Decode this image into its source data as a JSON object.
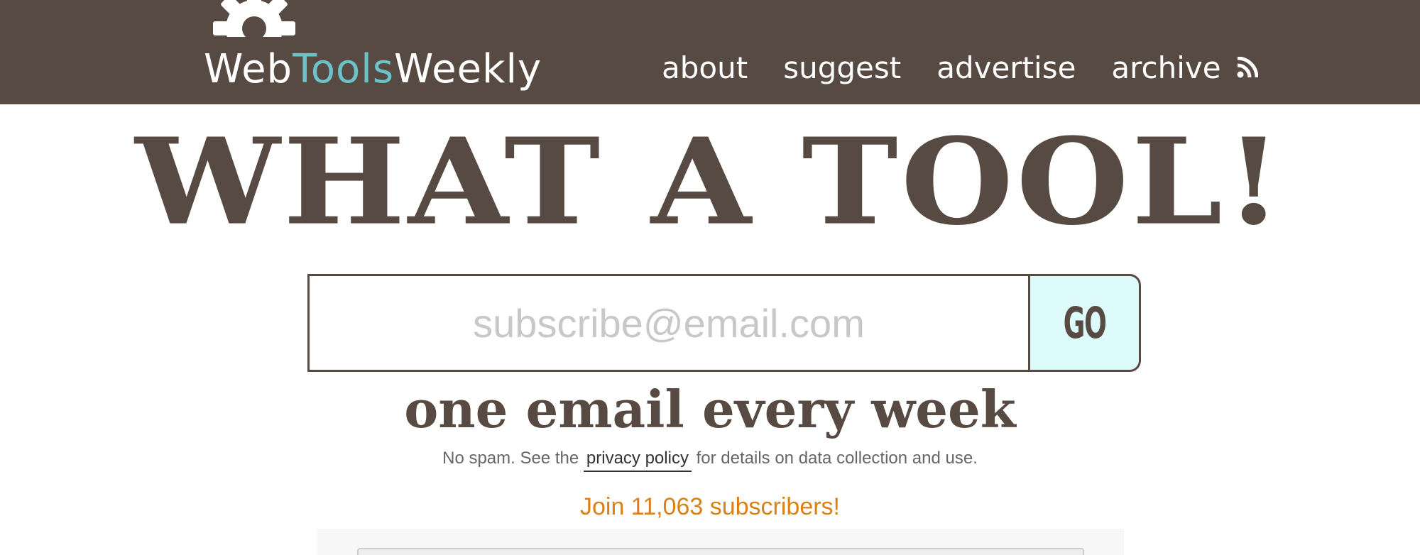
{
  "header": {
    "logo": {
      "part1": "Web",
      "part2": "Tools",
      "part3": "Weekly"
    },
    "nav": [
      {
        "label": "about"
      },
      {
        "label": "suggest"
      },
      {
        "label": "advertise"
      },
      {
        "label": "archive"
      }
    ],
    "rss_icon": "rss-icon"
  },
  "hero": {
    "headline": "WHAT A TOOL!",
    "email_placeholder": "subscribe@email.com",
    "go_label": "GO",
    "tagline": "one email every week",
    "policy": {
      "before": "No spam. See the",
      "link": "privacy policy",
      "after": "for details on data collection and use."
    },
    "subscribers": "Join 11,063 subscribers!"
  },
  "colors": {
    "brand_brown": "#574a42",
    "accent_teal": "#6bc2c9",
    "go_bg": "#ddfbfb",
    "subscribers": "#db8114"
  }
}
